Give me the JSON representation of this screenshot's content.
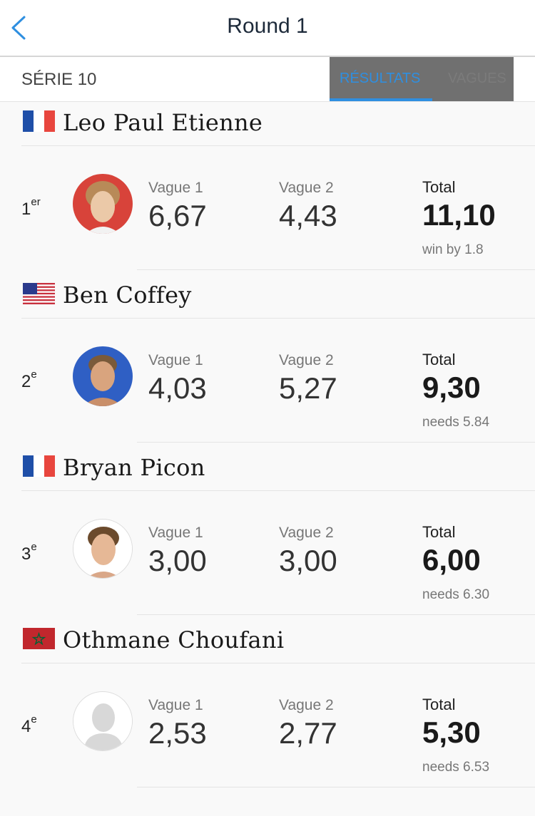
{
  "header": {
    "title": "Round 1"
  },
  "subbar": {
    "serie": "SÉRIE 10",
    "tab_results": "RÉSULTATS",
    "tab_waves": "VAGUES"
  },
  "labels": {
    "wave1": "Vague 1",
    "wave2": "Vague 2",
    "total": "Total"
  },
  "colors": {
    "accent": "#2f8fe0",
    "tab_bg": "#707070"
  },
  "surfers": [
    {
      "name": "Leo Paul Etienne",
      "flag": "france",
      "rank_num": "1",
      "rank_suffix": "er",
      "wave1": "6,67",
      "wave2": "4,43",
      "total": "11,10",
      "note": "win by 1.8",
      "avatar": "red-bg-photo"
    },
    {
      "name": "Ben Coffey",
      "flag": "usa",
      "rank_num": "2",
      "rank_suffix": "e",
      "wave1": "4,03",
      "wave2": "5,27",
      "total": "9,30",
      "note": "needs 5.84",
      "avatar": "blue-bg-photo"
    },
    {
      "name": "Bryan Picon",
      "flag": "france",
      "rank_num": "3",
      "rank_suffix": "e",
      "wave1": "3,00",
      "wave2": "3,00",
      "total": "6,00",
      "note": "needs 6.30",
      "avatar": "white-bg-photo"
    },
    {
      "name": "Othmane Choufani",
      "flag": "morocco",
      "rank_num": "4",
      "rank_suffix": "e",
      "wave1": "2,53",
      "wave2": "2,77",
      "total": "5,30",
      "note": "needs 6.53",
      "avatar": "placeholder-silhouette"
    }
  ]
}
